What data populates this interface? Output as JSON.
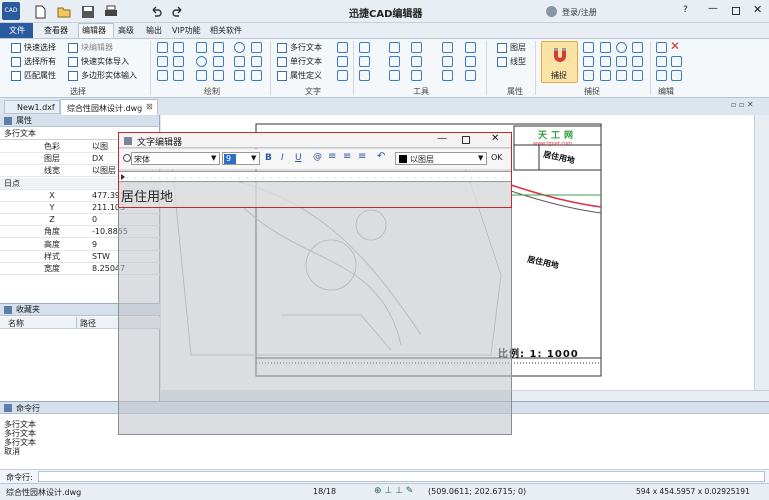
{
  "app": {
    "title": "迅捷CAD编辑器",
    "login": "登录/注册"
  },
  "menu": [
    "文件",
    "查看器",
    "编辑器",
    "高级",
    "输出",
    "VIP功能",
    "相关软件"
  ],
  "ribbon": {
    "select": [
      "快速选择",
      "选择所有",
      "匹配属性"
    ],
    "block": [
      "块编辑器",
      "快速实体导入",
      "多边形实体输入"
    ],
    "text": [
      "多行文本",
      "单行文本",
      "属性定义"
    ],
    "layers": [
      "图层",
      "线型"
    ],
    "snap": "捕捉",
    "groups": [
      "选择",
      "绘制",
      "文字",
      "工具",
      "属性",
      "捕捉",
      "编辑"
    ]
  },
  "tabs": [
    "New1.dxf",
    "综合性园林设计.dwg"
  ],
  "properties": {
    "title": "属性",
    "type": "多行文本",
    "rows": [
      {
        "k": "色彩",
        "v": "以图"
      },
      {
        "k": "图层",
        "v": "DX"
      },
      {
        "k": "线宽",
        "v": "以图层"
      },
      {
        "k": "日点",
        "v": ""
      },
      {
        "k": "X",
        "v": "477.395"
      },
      {
        "k": "Y",
        "v": "211.103"
      },
      {
        "k": "Z",
        "v": "0"
      },
      {
        "k": "角度",
        "v": "-10.8855"
      },
      {
        "k": "高度",
        "v": "9"
      },
      {
        "k": "样式",
        "v": "STW"
      },
      {
        "k": "宽度",
        "v": "8.25047"
      }
    ]
  },
  "favorites": {
    "title": "收藏夹",
    "col_name": "名称",
    "col_path": "路径"
  },
  "text_editor": {
    "title": "文字编辑器",
    "font": "宋体",
    "height": "9",
    "layer": "以图层",
    "ok": "OK",
    "content": "居住用地"
  },
  "drawing": {
    "logo": "天工网",
    "url": "www.tgnet.com",
    "stamp": "居住用地",
    "label": "居住用地",
    "scale": "比例: 1: 1000"
  },
  "command": {
    "title": "命令行",
    "lines": [
      "多行文本",
      "多行文本",
      "多行文本",
      "取消"
    ],
    "prompt": "命令行:"
  },
  "status": {
    "file": "综合性园林设计.dwg",
    "page": "18/18",
    "coords": "(509.0611; 202.6715; 0)",
    "size": "594 x 454.5957 x 0.02925191"
  },
  "colors": {
    "accent": "#2a5b9e",
    "red": "#c0282c"
  }
}
